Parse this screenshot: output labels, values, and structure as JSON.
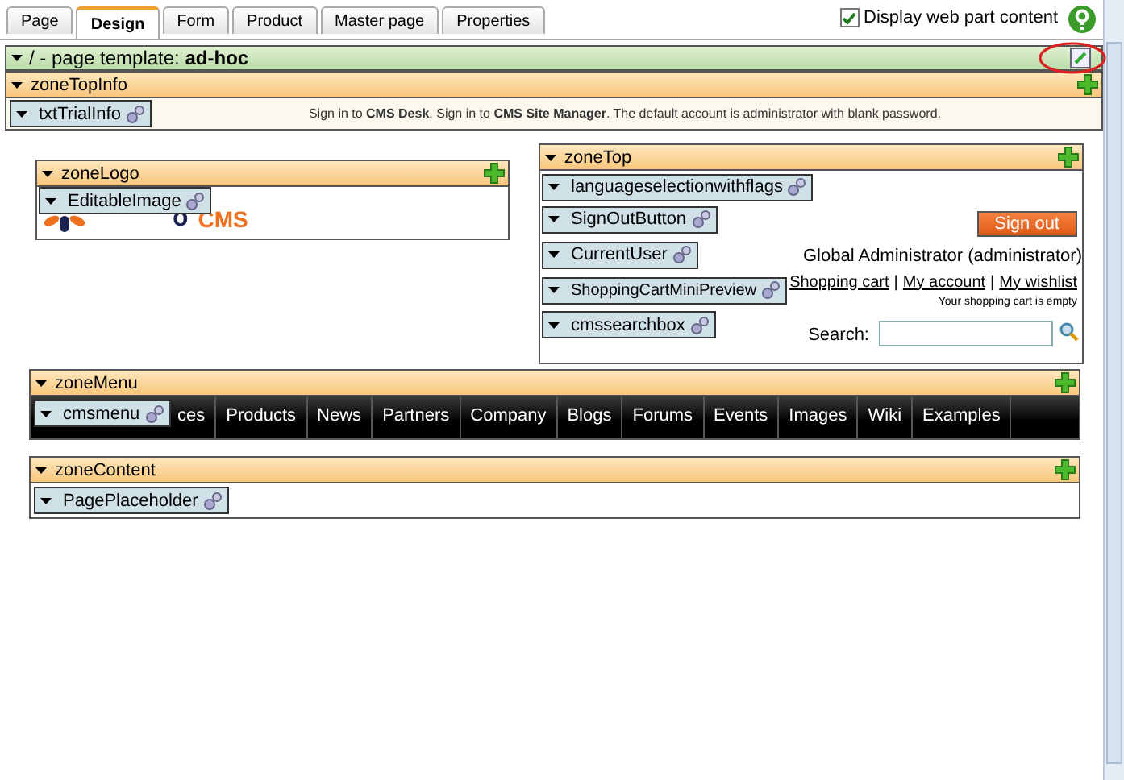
{
  "tabs": [
    {
      "label": "Page",
      "selected": false
    },
    {
      "label": "Design",
      "selected": true
    },
    {
      "label": "Form",
      "selected": false
    },
    {
      "label": "Product",
      "selected": false
    },
    {
      "label": "Master page",
      "selected": false
    },
    {
      "label": "Properties",
      "selected": false
    }
  ],
  "display_content": {
    "label": "Display web part content",
    "checked": true
  },
  "template": {
    "prefix": "/ - page template:",
    "name": "ad-hoc"
  },
  "zone_top_info": {
    "name": "zoneTopInfo",
    "webpart": "txtTrialInfo",
    "message": "Sign in to **CMS Desk**. Sign in to **CMS Site Manager**. The default account is administrator with blank password."
  },
  "zone_logo": {
    "name": "zoneLogo",
    "webpart": "EditableImage",
    "logo_visible_text": "o",
    "logo_brand": "CMS"
  },
  "zone_top": {
    "name": "zoneTop",
    "webparts": [
      {
        "kind": "plain",
        "name": "languageselectionwithflags"
      },
      {
        "kind": "button",
        "name": "SignOutButton",
        "label": "Sign out"
      },
      {
        "kind": "text",
        "name": "CurrentUser",
        "text": "Global Administrator (administrator)"
      },
      {
        "kind": "links",
        "name": "ShoppingCartMiniPreview",
        "links": [
          "Shopping cart",
          "My account",
          "My wishlist"
        ],
        "separator": "|",
        "note": "Your shopping cart is empty"
      },
      {
        "kind": "search",
        "name": "cmssearchbox",
        "label": "Search:"
      }
    ]
  },
  "zone_menu": {
    "name": "zoneMenu",
    "webpart": "cmsmenu",
    "items": [
      "ces",
      "Products",
      "News",
      "Partners",
      "Company",
      "Blogs",
      "Forums",
      "Events",
      "Images",
      "Wiki",
      "Examples"
    ]
  },
  "zone_content": {
    "name": "zoneContent",
    "webpart": "PagePlaceholder"
  }
}
